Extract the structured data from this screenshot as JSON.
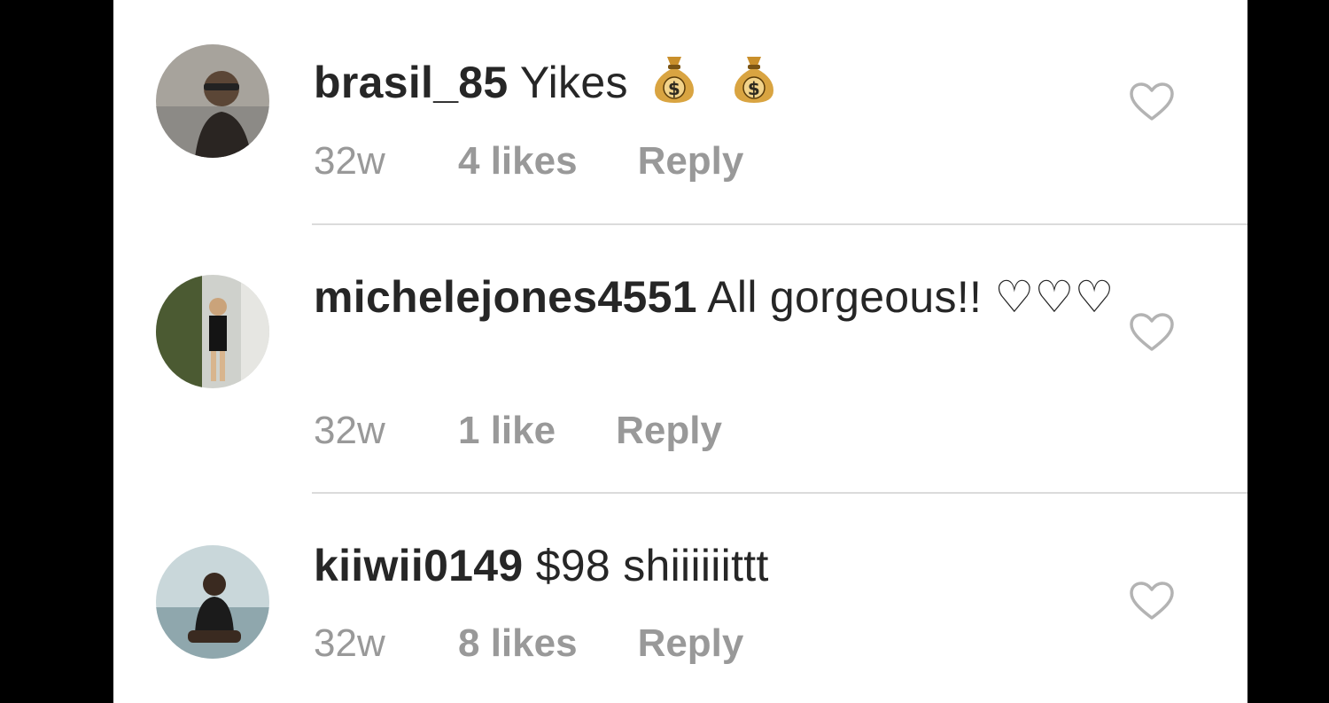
{
  "comments": [
    {
      "username": "brasil_85",
      "text": "Yikes",
      "emoji": "💰 💰",
      "time": "32w",
      "likes": "4 likes",
      "reply": "Reply",
      "avatar_color": "#8a7b6a"
    },
    {
      "username": "michelejones4551",
      "text": "All gorgeous!! ♡♡♡",
      "time": "32w",
      "likes": "1 like",
      "reply": "Reply",
      "avatar_color": "#6f7a5a"
    },
    {
      "username": "kiiwii0149",
      "text": "$98 shiiiiiittt",
      "time": "32w",
      "likes": "8 likes",
      "reply": "Reply",
      "avatar_color": "#9fb2b8"
    }
  ],
  "icons": {
    "like": "heart-outline-icon",
    "money": "money-bag-icon"
  },
  "colors": {
    "text": "#262626",
    "muted": "#999999",
    "divider": "#dbdbdb",
    "heart_stroke": "#b3b3b3"
  }
}
